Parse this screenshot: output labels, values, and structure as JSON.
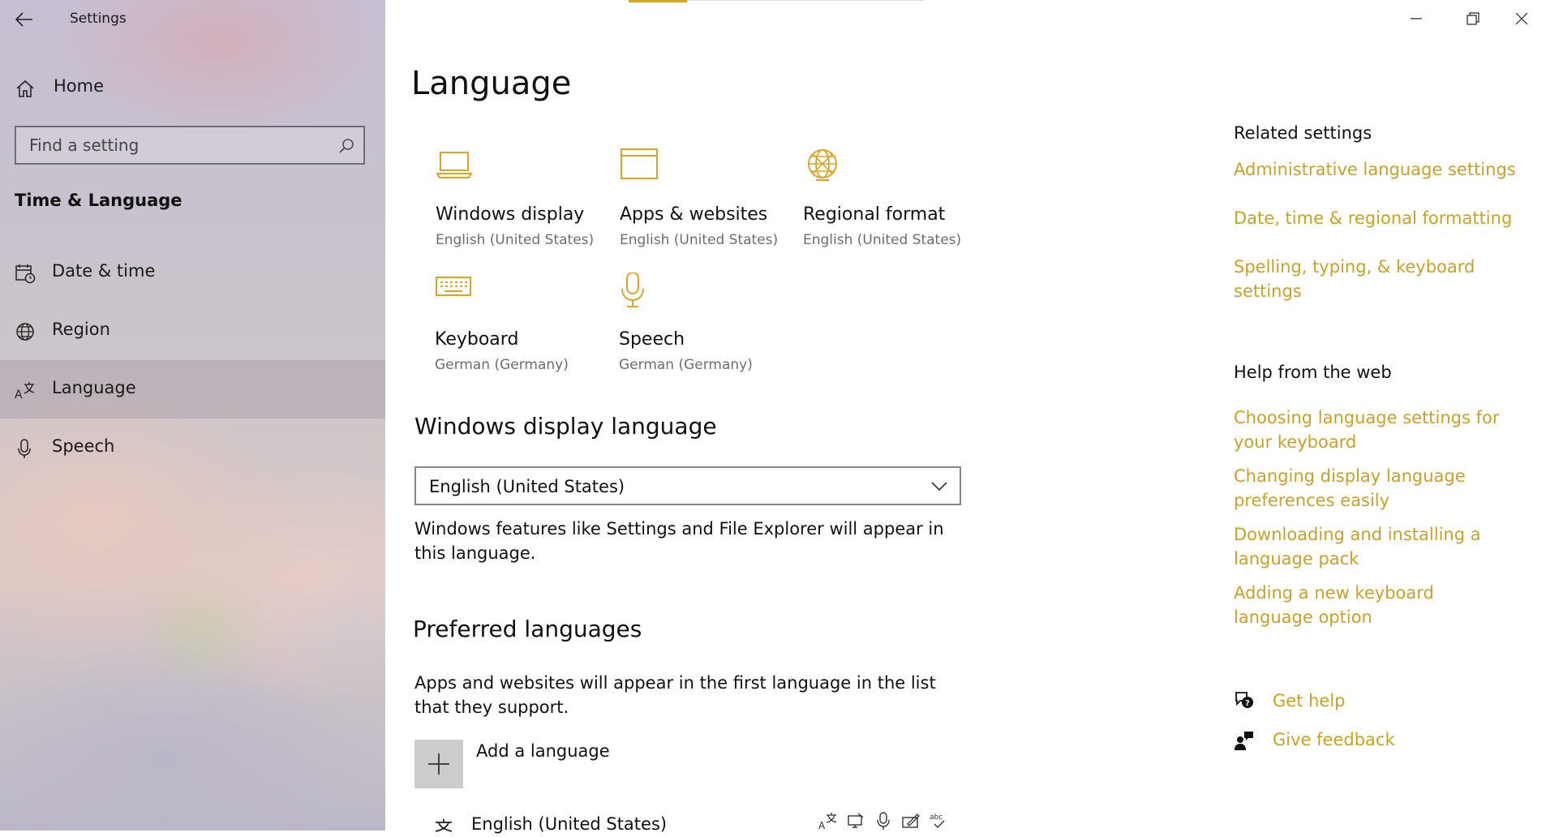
{
  "window": {
    "title": "Settings",
    "minimize_icon": "minimize-icon",
    "restore_icon": "restore-icon",
    "close_icon": "close-icon"
  },
  "sidebar": {
    "home_label": "Home",
    "search_placeholder": "Find a setting",
    "section_title": "Time & Language",
    "items": [
      {
        "label": "Date & time",
        "icon": "calendar-clock-icon"
      },
      {
        "label": "Region",
        "icon": "globe-icon"
      },
      {
        "label": "Language",
        "icon": "language-icon",
        "selected": true
      },
      {
        "label": "Speech",
        "icon": "microphone-icon"
      }
    ]
  },
  "main": {
    "title": "Language",
    "tiles": [
      {
        "label": "Windows display",
        "sub": "English (United States)",
        "icon": "laptop-icon"
      },
      {
        "label": "Apps & websites",
        "sub": "English (United States)",
        "icon": "browser-window-icon"
      },
      {
        "label": "Regional format",
        "sub": "English (United States)",
        "icon": "globe-icon"
      },
      {
        "label": "Keyboard",
        "sub": "German (Germany)",
        "icon": "keyboard-icon"
      },
      {
        "label": "Speech",
        "sub": "German (Germany)",
        "icon": "microphone-icon"
      }
    ],
    "display_language": {
      "heading": "Windows display language",
      "selected": "English (United States)",
      "description": "Windows features like Settings and File Explorer will appear in this language."
    },
    "preferred": {
      "heading": "Preferred languages",
      "description": "Apps and websites will appear in the first language in the list that they support.",
      "add_label": "Add a language",
      "languages": [
        {
          "name": "English (United States)"
        }
      ]
    }
  },
  "related": {
    "heading": "Related settings",
    "links": [
      "Administrative language settings",
      "Date, time & regional formatting",
      "Spelling, typing, & keyboard settings"
    ]
  },
  "help": {
    "heading": "Help from the web",
    "links": [
      "Choosing language settings for your keyboard",
      "Changing display language preferences easily",
      "Downloading and installing a language pack",
      "Adding a new keyboard language option"
    ],
    "get_help": "Get help",
    "give_feedback": "Give feedback"
  },
  "colors": {
    "accent": "#c8a128",
    "icon_accent": "#d7a52a",
    "selected_bg": "#b0a8b6"
  }
}
